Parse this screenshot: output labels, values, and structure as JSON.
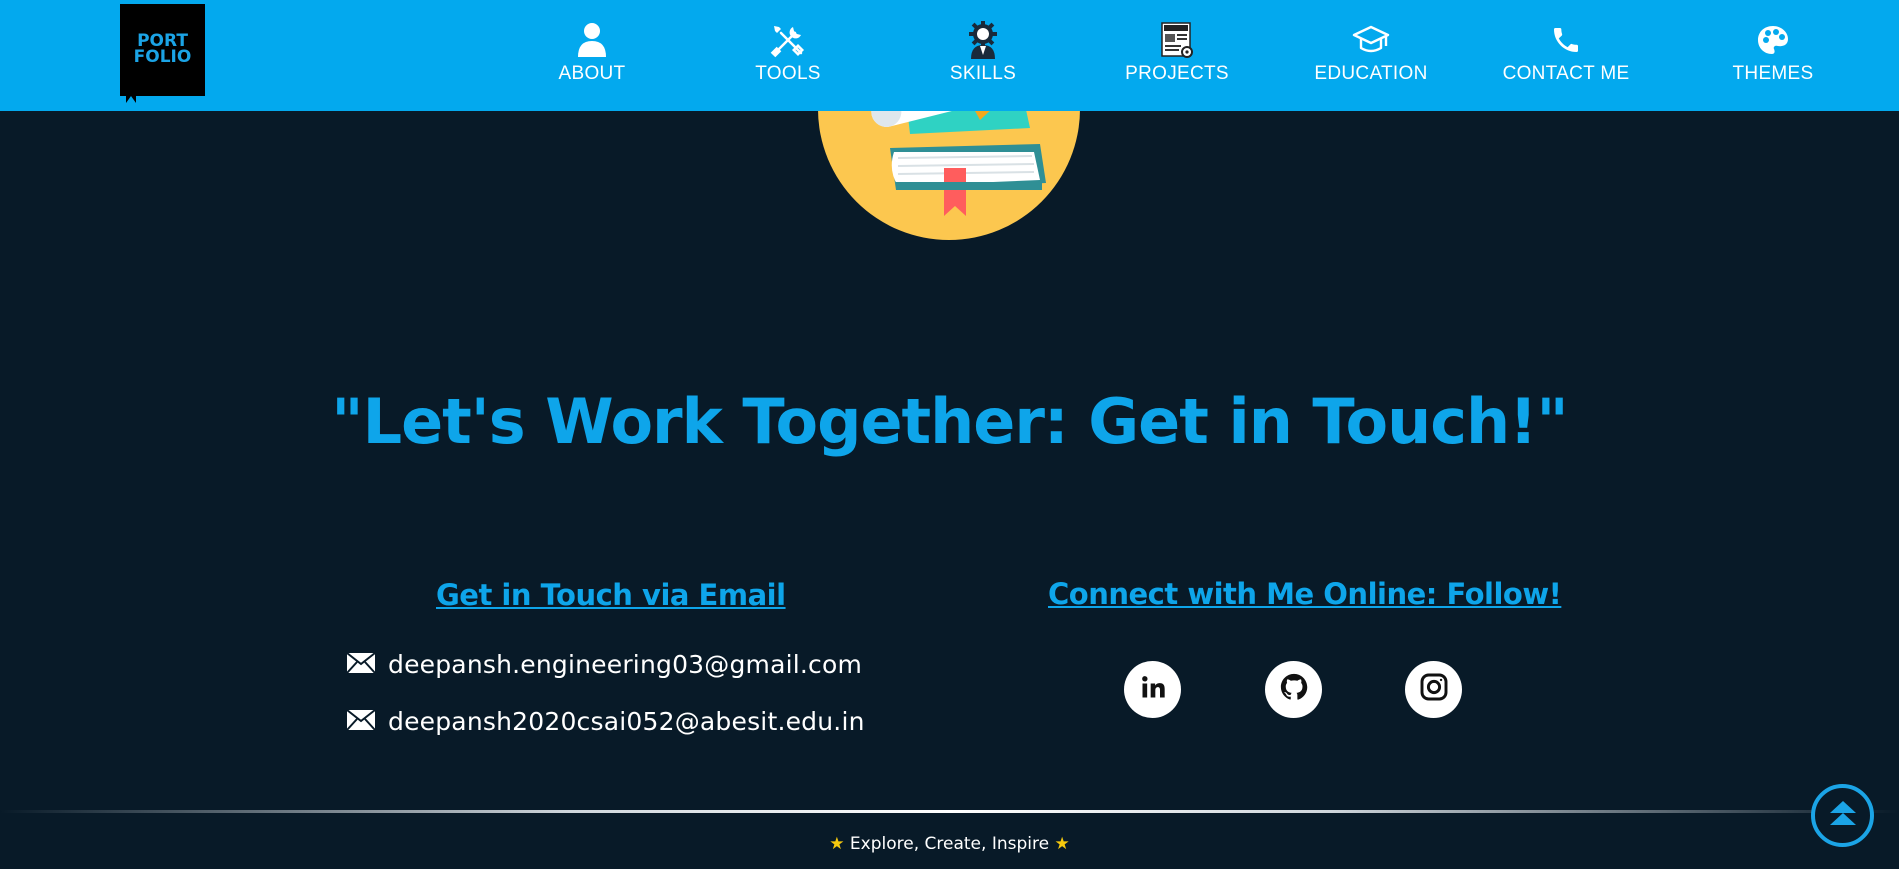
{
  "header": {
    "logo": {
      "line1": "PORT",
      "line2": "FOLIO"
    },
    "nav": [
      {
        "label": "ABOUT",
        "icon": "user-icon"
      },
      {
        "label": "TOOLS",
        "icon": "tools-icon"
      },
      {
        "label": "SKILLS",
        "icon": "skills-icon"
      },
      {
        "label": "PROJECTS",
        "icon": "project-icon"
      },
      {
        "label": "EDUCATION",
        "icon": "graduation-cap-icon"
      },
      {
        "label": "CONTACT ME",
        "icon": "phone-icon"
      },
      {
        "label": "THEMES",
        "icon": "palette-icon"
      }
    ]
  },
  "hero": {
    "image": "books-diploma-icon"
  },
  "main": {
    "headline": "\"Let's Work Together: Get in Touch!\"",
    "email_section": {
      "title": "Get in Touch via Email",
      "emails": [
        "deepansh.engineering03@gmail.com",
        "deepansh2020csai052@abesit.edu.in"
      ]
    },
    "social_section": {
      "title": "Connect with Me Online: Follow!",
      "links": [
        {
          "icon": "linkedin-icon"
        },
        {
          "icon": "github-icon"
        },
        {
          "icon": "instagram-icon"
        }
      ]
    }
  },
  "footer": {
    "tagline": "Explore, Create, Inspire",
    "icon": "star-icon"
  },
  "scroll_top": {
    "icon": "double-chevron-up-icon"
  },
  "colors": {
    "header_bg": "#03a9ee",
    "page_bg": "#081a28",
    "accent": "#0ea5ea"
  }
}
